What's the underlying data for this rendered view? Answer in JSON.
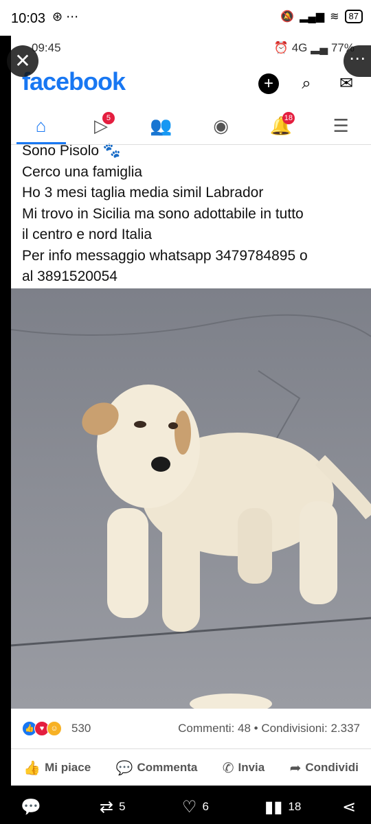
{
  "outer_status": {
    "time": "10:03",
    "battery": "87"
  },
  "inner_status": {
    "time": "09:45",
    "battery_pct": "77%",
    "network": "4G"
  },
  "facebook": {
    "logo": "facebook",
    "tab_badges": {
      "video": "5",
      "notifications": "18"
    }
  },
  "post": {
    "lines": [
      "Sono Pisolo 🐾",
      "Cerco una famiglia",
      "Ho 3 mesi taglia media simil Labrador",
      "Mi trovo in Sicilia ma sono adottabile in tutto",
      "il centro e nord Italia",
      "Per info messaggio whatsapp 3479784895 o",
      "al 3891520054"
    ],
    "reaction_count": "530",
    "stats": "Commenti: 48 • Condivisioni: 2.337",
    "actions": {
      "like": "Mi piace",
      "comment": "Commenta",
      "send": "Invia",
      "share": "Condividi"
    }
  },
  "bottom_bar": {
    "retweets": "5",
    "likes": "6",
    "views": "18"
  },
  "icons": [
    "close-icon",
    "more-icon",
    "add-icon",
    "search-icon",
    "messenger-icon",
    "home-icon",
    "video-icon",
    "friends-icon",
    "profile-icon",
    "bell-icon",
    "menu-icon",
    "like-icon",
    "comment-icon",
    "send-icon",
    "share-icon",
    "reply-icon",
    "retweet-icon",
    "heart-icon",
    "views-icon"
  ],
  "colors": {
    "fb_blue": "#1877f2",
    "badge_red": "#e41e3f"
  }
}
